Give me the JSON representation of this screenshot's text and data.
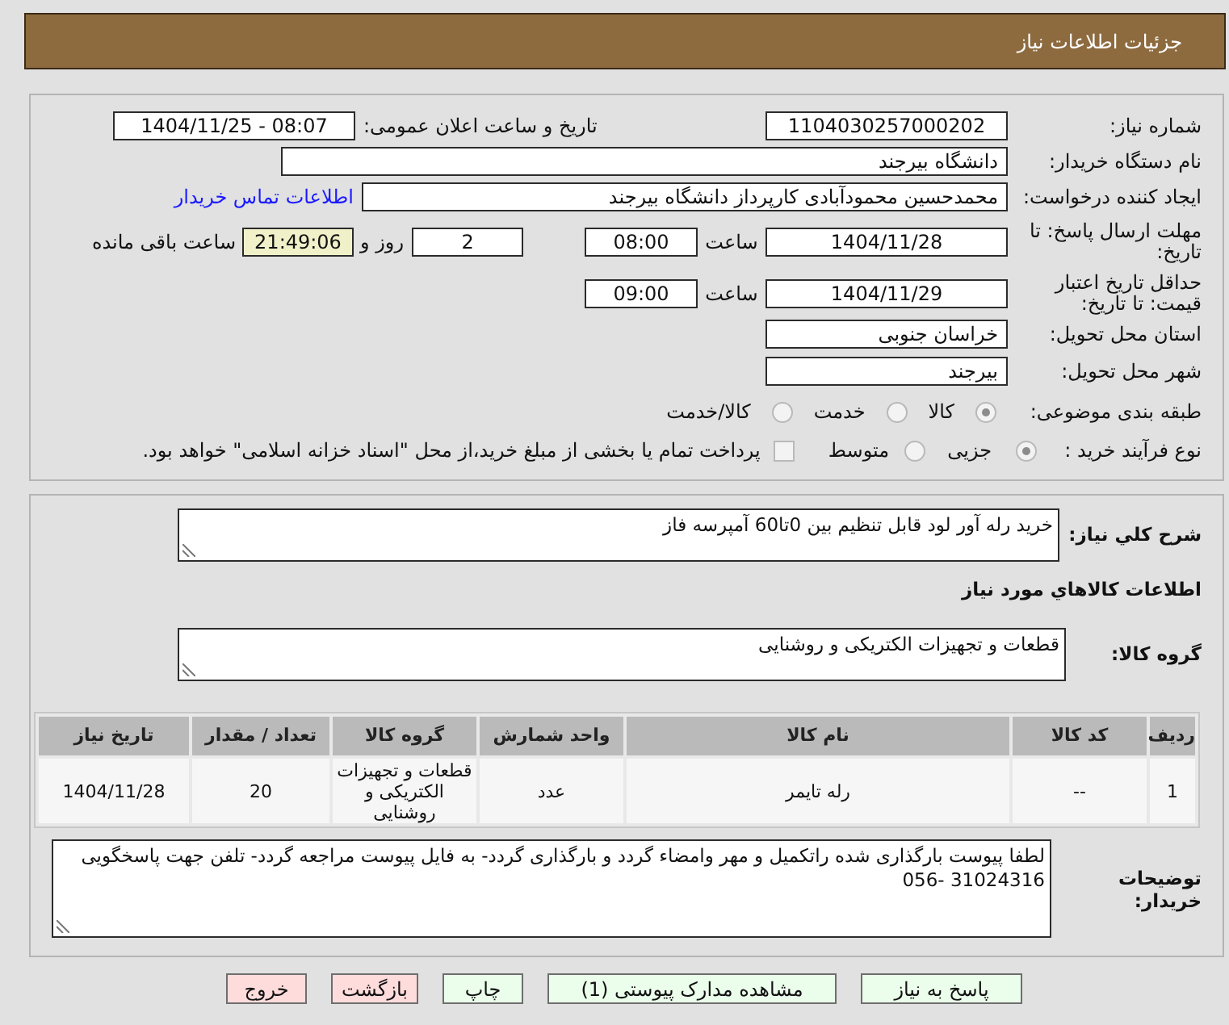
{
  "header": {
    "title": "جزئیات اطلاعات نیاز"
  },
  "details": {
    "need_number": {
      "label": "شماره نیاز:",
      "value": "1104030257000202"
    },
    "announcement": {
      "label": "تاریخ و ساعت اعلان عمومی:",
      "value": "1404/11/25 - 08:07"
    },
    "buyer_organization": {
      "label": "نام دستگاه خریدار:",
      "value": "دانشگاه بیرجند"
    },
    "requester": {
      "label": "ایجاد کننده درخواست:",
      "value": "محمدحسین محمودآبادی کارپرداز دانشگاه بیرجند",
      "link": "اطلاعات تماس خریدار"
    },
    "response_deadline": {
      "label": "مهلت ارسال پاسخ: تا تاریخ:",
      "date": "1404/11/28",
      "time_label": "ساعت",
      "time": "08:00",
      "days": "2",
      "days_label": "روز و",
      "remaining": "21:49:06",
      "remaining_label": "ساعت باقی مانده"
    },
    "price_validity": {
      "label": "حداقل تاریخ اعتبار قیمت: تا تاریخ:",
      "date": "1404/11/29",
      "time_label": "ساعت",
      "time": "09:00"
    },
    "delivery_province": {
      "label": "استان محل تحویل:",
      "value": "خراسان جنوبی"
    },
    "delivery_city": {
      "label": "شهر محل تحویل:",
      "value": "بیرجند"
    },
    "subject_category": {
      "label": "طبقه بندی موضوعی:",
      "options": [
        {
          "label": "کالا",
          "selected": true
        },
        {
          "label": "خدمت",
          "selected": false
        },
        {
          "label": "کالا/خدمت",
          "selected": false
        }
      ]
    },
    "purchase_process": {
      "label": "نوع فرآیند خرید :",
      "options": [
        {
          "label": "جزیی",
          "selected": true
        },
        {
          "label": "متوسط",
          "selected": false
        }
      ],
      "treasury_payment": {
        "checked": false,
        "text": "پرداخت تمام یا بخشی از مبلغ خرید،از محل \"اسناد خزانه اسلامی\" خواهد بود."
      }
    }
  },
  "need": {
    "summary": {
      "label": "شرح کلي نیاز:",
      "value": "خرید رله آور لود قابل تنظیم بین 0تا60 آمپرسه فاز"
    },
    "goods_heading": "اطلاعات کالاهاي مورد نیاز",
    "goods_group": {
      "label": "گروه کالا:",
      "value": "قطعات و تجهیزات الکتریکی و روشنایی"
    },
    "table": {
      "columns": [
        "ردیف",
        "کد کالا",
        "نام کالا",
        "واحد شمارش",
        "گروه کالا",
        "تعداد / مقدار",
        "تاریخ نیاز"
      ],
      "rows": [
        [
          "1",
          "--",
          "رله تایمر",
          "عدد",
          "قطعات و تجهیزات الکتریکی و روشنایی",
          "20",
          "1404/11/28"
        ]
      ]
    },
    "buyer_notes": {
      "label": "توضیحات خریدار:",
      "value": "لطفا پیوست بارگذاری شده راتکمیل و مهر وامضاء گردد و بارگذاری گردد- به فایل پیوست مراجعه گردد- تلفن جهت پاسخگویی 31024316 -056"
    }
  },
  "buttons": [
    {
      "label": "پاسخ به نیاز",
      "kind": "action"
    },
    {
      "label": "مشاهده مدارک پیوستی (1)",
      "kind": "action"
    },
    {
      "label": "چاپ",
      "kind": "action"
    },
    {
      "label": "بازگشت",
      "kind": "exit"
    },
    {
      "label": "خروج",
      "kind": "exit"
    }
  ]
}
